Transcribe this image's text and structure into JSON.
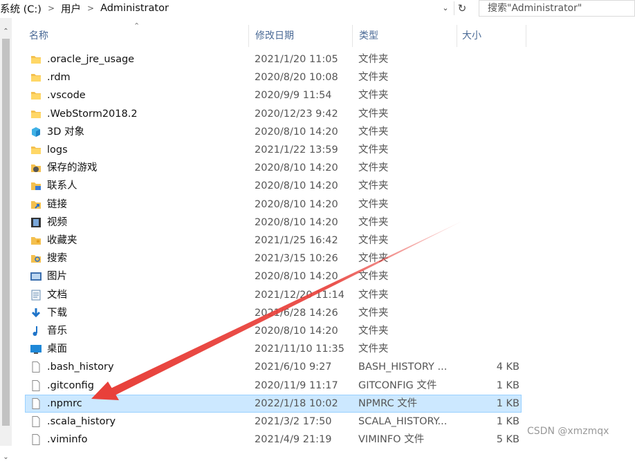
{
  "address": {
    "crumbs": [
      "系统 (C:)",
      "用户",
      "Administrator"
    ],
    "search_placeholder": "搜索\"Administrator\""
  },
  "columns": {
    "name": "名称",
    "date": "修改日期",
    "type": "类型",
    "size": "大小"
  },
  "files": [
    {
      "name": ".oracle_jre_usage",
      "date": "2021/1/20 11:05",
      "type": "文件夹",
      "size": "",
      "icon": "folder-icon"
    },
    {
      "name": ".rdm",
      "date": "2020/8/20 10:08",
      "type": "文件夹",
      "size": "",
      "icon": "folder-icon"
    },
    {
      "name": ".vscode",
      "date": "2020/9/9 11:54",
      "type": "文件夹",
      "size": "",
      "icon": "folder-icon"
    },
    {
      "name": ".WebStorm2018.2",
      "date": "2020/12/23 9:42",
      "type": "文件夹",
      "size": "",
      "icon": "folder-icon"
    },
    {
      "name": "3D 对象",
      "date": "2020/8/10 14:20",
      "type": "文件夹",
      "size": "",
      "icon": "3d-objects-icon"
    },
    {
      "name": "logs",
      "date": "2021/1/22 13:59",
      "type": "文件夹",
      "size": "",
      "icon": "folder-icon"
    },
    {
      "name": "保存的游戏",
      "date": "2020/8/10 14:20",
      "type": "文件夹",
      "size": "",
      "icon": "saved-games-icon"
    },
    {
      "name": "联系人",
      "date": "2020/8/10 14:20",
      "type": "文件夹",
      "size": "",
      "icon": "contacts-icon"
    },
    {
      "name": "链接",
      "date": "2020/8/10 14:20",
      "type": "文件夹",
      "size": "",
      "icon": "links-icon"
    },
    {
      "name": "视频",
      "date": "2020/8/10 14:20",
      "type": "文件夹",
      "size": "",
      "icon": "videos-icon"
    },
    {
      "name": "收藏夹",
      "date": "2021/1/25 16:42",
      "type": "文件夹",
      "size": "",
      "icon": "favorites-icon"
    },
    {
      "name": "搜索",
      "date": "2021/3/15 10:26",
      "type": "文件夹",
      "size": "",
      "icon": "searches-icon"
    },
    {
      "name": "图片",
      "date": "2020/8/10 14:20",
      "type": "文件夹",
      "size": "",
      "icon": "pictures-icon"
    },
    {
      "name": "文档",
      "date": "2021/12/20 11:14",
      "type": "文件夹",
      "size": "",
      "icon": "documents-icon"
    },
    {
      "name": "下载",
      "date": "2021/6/28 14:26",
      "type": "文件夹",
      "size": "",
      "icon": "downloads-icon"
    },
    {
      "name": "音乐",
      "date": "2020/8/10 14:20",
      "type": "文件夹",
      "size": "",
      "icon": "music-icon"
    },
    {
      "name": "桌面",
      "date": "2021/11/10 11:35",
      "type": "文件夹",
      "size": "",
      "icon": "desktop-icon"
    },
    {
      "name": ".bash_history",
      "date": "2021/6/10 9:27",
      "type": "BASH_HISTORY ...",
      "size": "4 KB",
      "icon": "file-icon"
    },
    {
      "name": ".gitconfig",
      "date": "2020/11/9 11:17",
      "type": "GITCONFIG 文件",
      "size": "1 KB",
      "icon": "file-icon"
    },
    {
      "name": ".npmrc",
      "date": "2022/1/18 10:02",
      "type": "NPMRC 文件",
      "size": "1 KB",
      "icon": "file-icon"
    },
    {
      "name": ".scala_history",
      "date": "2021/3/2 17:50",
      "type": "SCALA_HISTORY...",
      "size": "1 KB",
      "icon": "file-icon"
    },
    {
      "name": ".viminfo",
      "date": "2021/4/9 21:19",
      "type": "VIMINFO 文件",
      "size": "5 KB",
      "icon": "file-icon"
    }
  ],
  "selected_file": ".npmrc",
  "colors": {
    "selection_bg": "#cce8ff",
    "selection_border": "#99d1ff",
    "annotation_arrow": "#e8403a",
    "folder": "#f4c04e"
  },
  "watermark": "CSDN @xmzmqx"
}
